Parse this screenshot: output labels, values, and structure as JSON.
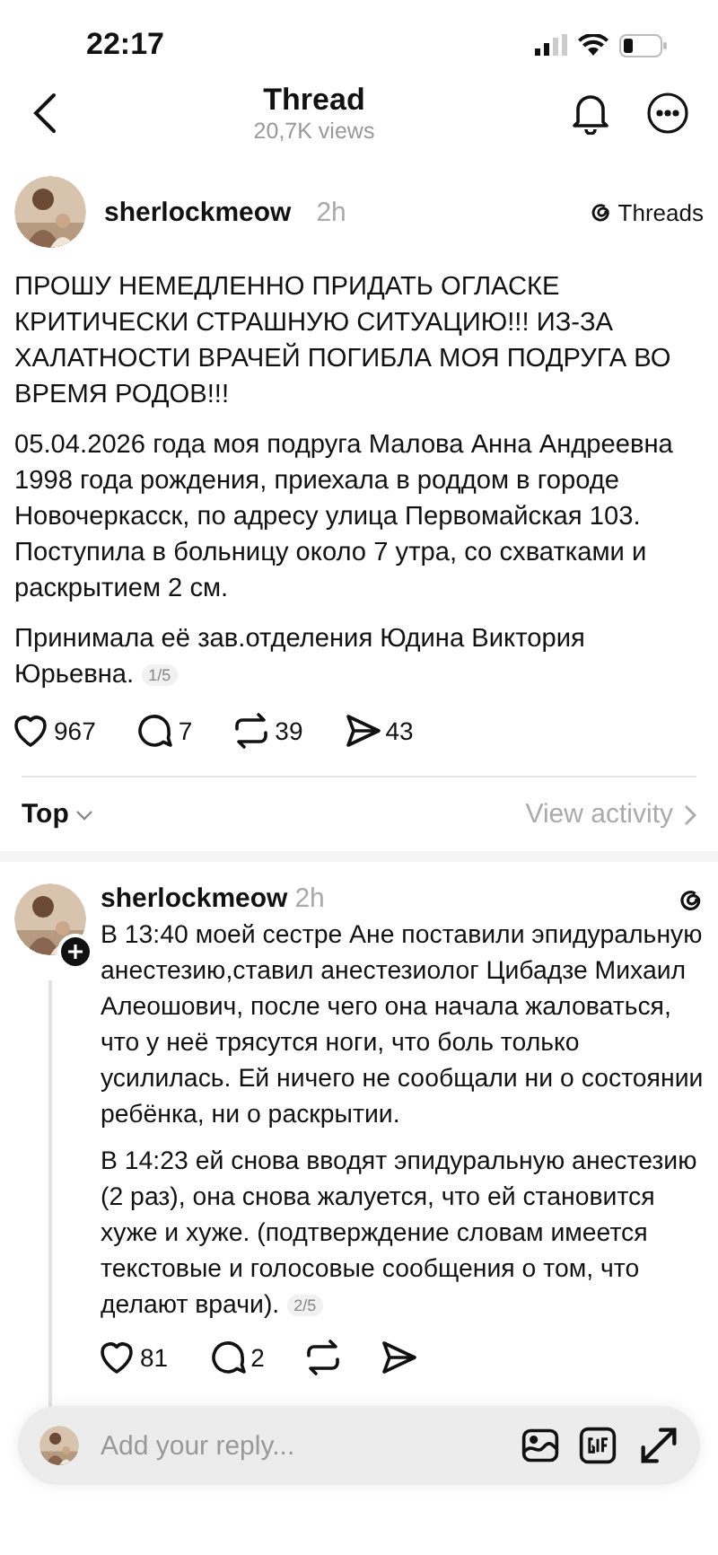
{
  "status_bar": {
    "time": "22:17"
  },
  "header": {
    "title": "Thread",
    "subtitle": "20,7K views"
  },
  "post": {
    "username": "sherlockmeow",
    "time": "2h",
    "source": "Threads",
    "paragraphs": [
      "ПРОШУ НЕМЕДЛЕННО ПРИДАТЬ ОГЛАСКЕ КРИТИЧЕСКИ СТРАШНУЮ СИТУАЦИЮ!!! ИЗ-ЗА ХАЛАТНОСТИ ВРАЧЕЙ ПОГИБЛА МОЯ ПОДРУГА ВО ВРЕМЯ РОДОВ!!!",
      "05.04.2026 года моя подруга Малова Анна Андреевна 1998 года рождения, приехала в роддом в городе Новочеркасск, по адресу улица Первомайская 103. Поступила в больницу около 7 утра, со схватками и раскрытием 2 см.",
      "Принимала её зав.отделения Юдина Виктория Юрьевна."
    ],
    "page": "1/5",
    "actions": [
      {
        "kind": "like",
        "count": "967"
      },
      {
        "kind": "comment",
        "count": "7"
      },
      {
        "kind": "repost",
        "count": "39"
      },
      {
        "kind": "share",
        "count": "43"
      }
    ]
  },
  "sort": {
    "label": "Top",
    "link": "View activity"
  },
  "replies": [
    {
      "username": "sherlockmeow",
      "time": "2h",
      "paragraphs": [
        "В 13:40 моей сестре Ане поставили эпидуральную анестезию,ставил анестезиолог Цибадзе Михаил Алеошович, после чего она начала жаловаться, что у неё трясутся ноги, что боль только усилилась. Ей ничего не сообщали ни о состоянии ребёнка, ни о раскрытии.",
        "В 14:23 ей снова вводят эпидуральную анестезию (2 раз), она снова жалуется, что ей становится хуже и хуже. (подтверждение словам имеется текстовые и голосовые сообщения о том, что делают врачи)."
      ],
      "page": "2/5",
      "actions": [
        {
          "kind": "like",
          "count": "81"
        },
        {
          "kind": "comment",
          "count": "2"
        },
        {
          "kind": "repost"
        },
        {
          "kind": "share"
        }
      ]
    }
  ],
  "reply_bar": {
    "placeholder": "Add your reply..."
  }
}
